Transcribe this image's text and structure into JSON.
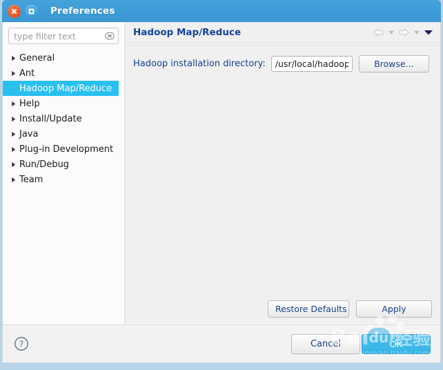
{
  "window": {
    "title": "Preferences",
    "close_label": "Close",
    "maximize_label": "Maximize",
    "titlebar_color": "#3d9cd8"
  },
  "sidebar": {
    "filter": {
      "placeholder": "type filter text",
      "value": "",
      "clear_icon": "clear-icon"
    },
    "items": [
      {
        "label": "General",
        "expandable": true,
        "selected": false
      },
      {
        "label": "Ant",
        "expandable": true,
        "selected": false
      },
      {
        "label": "Hadoop Map/Reduce",
        "expandable": false,
        "selected": true
      },
      {
        "label": "Help",
        "expandable": true,
        "selected": false
      },
      {
        "label": "Install/Update",
        "expandable": true,
        "selected": false
      },
      {
        "label": "Java",
        "expandable": true,
        "selected": false
      },
      {
        "label": "Plug-in Development",
        "expandable": true,
        "selected": false
      },
      {
        "label": "Run/Debug",
        "expandable": true,
        "selected": false
      },
      {
        "label": "Team",
        "expandable": true,
        "selected": false
      }
    ],
    "selection_color": "#29c0f0"
  },
  "content": {
    "title": "Hadoop Map/Reduce",
    "title_color": "#15459c",
    "nav": {
      "back_icon": "arrow-left-icon",
      "back_menu_icon": "chevron-down-icon",
      "forward_icon": "arrow-right-icon",
      "forward_menu_icon": "chevron-down-icon",
      "view_menu_icon": "chevron-down-filled-icon"
    },
    "form": {
      "directory_label": "Hadoop installation directory:",
      "directory_value": "/usr/local/hadoop",
      "directory_placeholder": "",
      "browse_label": "Browse..."
    },
    "restore_defaults_label": "Restore Defaults",
    "apply_label": "Apply"
  },
  "footer": {
    "help_icon": "help-circle-icon",
    "cancel_label": "Cancel",
    "ok_label": "OK",
    "ok_color": "#3fb9e8"
  },
  "watermark": {
    "brand": "Baidu",
    "suffix": "经验",
    "domain": "jingyan.baidu.com"
  }
}
